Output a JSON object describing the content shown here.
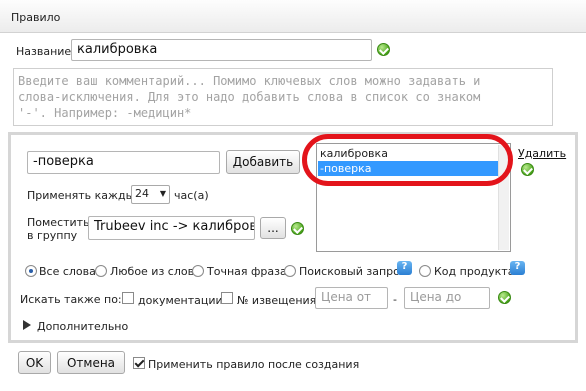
{
  "window": {
    "title": "Правило"
  },
  "name": {
    "label": "Название:",
    "value": "калибровка"
  },
  "comment": {
    "placeholder": "Введите ваш комментарий... Помимо ключевых слов можно задавать и слова-исключения. Для это надо добавить слова в список со знаком '-'. Например: -медицин*",
    "lines": [
      "Введите ваш комментарий... Помимо ключевых слов можно задавать и",
      "слова-исключения. Для это надо добавить слова в список со знаком",
      "'-'. Например: -медицин*"
    ]
  },
  "keyword": {
    "value": "-поверка",
    "add_button": "Добавить"
  },
  "keywords_list": {
    "items": [
      "калибровка",
      "-поверка"
    ],
    "selected_index": 1
  },
  "delete_link": "Удалить",
  "apply_every": {
    "label": "Применять каждые",
    "value": "24",
    "unit": "час(а)"
  },
  "group": {
    "label_line1": "Поместить",
    "label_line2": "в группу",
    "value": "Trubeev inc -> калибровк",
    "browse_button": "..."
  },
  "match_mode": {
    "options": [
      "Все слова",
      "Любое из слов",
      "Точная фраза",
      "Поисковый запрос",
      "Код продукта"
    ],
    "selected_index": 0
  },
  "search_also": {
    "label": "Искать также по:",
    "docs_label": "документации",
    "notices_label": "№ извещения",
    "price_from_placeholder": "Цена от",
    "dash": "-",
    "price_to_placeholder": "Цена до"
  },
  "advanced": {
    "label": "Дополнительно"
  },
  "footer": {
    "ok_button": "OK",
    "cancel_button": "Отмена",
    "apply_after_create": "Применить правило после создания",
    "apply_checked": true
  },
  "icons": {
    "ok": "checkmark-circle-icon",
    "help": "question-icon",
    "expand": "triangle-right-icon"
  },
  "colors": {
    "accent_selected": "#3399ff",
    "highlight_oval": "#e3141b",
    "ok_green": "#4aa51b"
  }
}
